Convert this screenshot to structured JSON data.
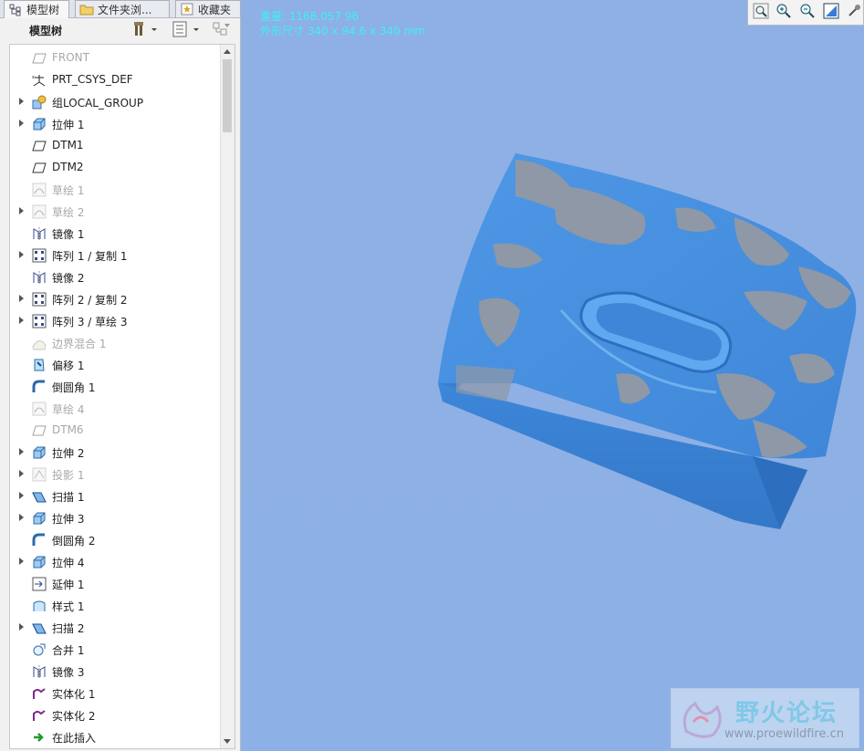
{
  "tabs": [
    {
      "label": "模型树",
      "icon": "model-tree-icon",
      "active": true
    },
    {
      "label": "文件夹浏...",
      "icon": "folder-icon",
      "active": false
    },
    {
      "label": "收藏夹",
      "icon": "favorites-icon",
      "active": false
    }
  ],
  "toolbar": {
    "title": "模型树",
    "settings_icon": "tools-settings-icon",
    "show_icon": "show-list-icon",
    "filter_icon": "filter-icon"
  },
  "tree": [
    {
      "label": "FRONT",
      "icon": "datum-plane-icon",
      "expandable": false,
      "dim": true
    },
    {
      "label": "PRT_CSYS_DEF",
      "icon": "csys-icon",
      "expandable": false,
      "dim": false
    },
    {
      "label": "组LOCAL_GROUP",
      "icon": "group-icon",
      "expandable": true,
      "dim": false
    },
    {
      "label": "拉伸 1",
      "icon": "extrude-icon",
      "expandable": true,
      "dim": false
    },
    {
      "label": "DTM1",
      "icon": "datum-plane-icon",
      "expandable": false,
      "dim": false
    },
    {
      "label": "DTM2",
      "icon": "datum-plane-icon",
      "expandable": false,
      "dim": false
    },
    {
      "label": "草绘 1",
      "icon": "sketch-icon",
      "expandable": false,
      "dim": true
    },
    {
      "label": "草绘 2",
      "icon": "sketch-icon",
      "expandable": true,
      "dim": true
    },
    {
      "label": "镜像 1",
      "icon": "mirror-icon",
      "expandable": false,
      "dim": false
    },
    {
      "label": "阵列 1 / 复制 1",
      "icon": "pattern-icon",
      "expandable": true,
      "dim": false
    },
    {
      "label": "镜像 2",
      "icon": "mirror-icon",
      "expandable": false,
      "dim": false
    },
    {
      "label": "阵列 2 / 复制 2",
      "icon": "pattern-icon",
      "expandable": true,
      "dim": false
    },
    {
      "label": "阵列 3 / 草绘 3",
      "icon": "pattern-icon",
      "expandable": true,
      "dim": false
    },
    {
      "label": "边界混合 1",
      "icon": "boundary-blend-icon",
      "expandable": false,
      "dim": true
    },
    {
      "label": "偏移 1",
      "icon": "offset-icon",
      "expandable": false,
      "dim": false
    },
    {
      "label": "倒圆角 1",
      "icon": "round-icon",
      "expandable": false,
      "dim": false
    },
    {
      "label": "草绘 4",
      "icon": "sketch-icon",
      "expandable": false,
      "dim": true
    },
    {
      "label": "DTM6",
      "icon": "datum-plane-icon",
      "expandable": false,
      "dim": true
    },
    {
      "label": "拉伸 2",
      "icon": "extrude-icon",
      "expandable": true,
      "dim": false
    },
    {
      "label": "投影 1",
      "icon": "projection-icon",
      "expandable": true,
      "dim": true
    },
    {
      "label": "扫描 1",
      "icon": "sweep-icon",
      "expandable": true,
      "dim": false
    },
    {
      "label": "拉伸 3",
      "icon": "extrude-icon",
      "expandable": true,
      "dim": false
    },
    {
      "label": "倒圆角 2",
      "icon": "round-icon",
      "expandable": false,
      "dim": false
    },
    {
      "label": "拉伸 4",
      "icon": "extrude-icon",
      "expandable": true,
      "dim": false
    },
    {
      "label": "延伸 1",
      "icon": "extend-icon",
      "expandable": false,
      "dim": false
    },
    {
      "label": "样式 1",
      "icon": "style-icon",
      "expandable": false,
      "dim": false
    },
    {
      "label": "扫描 2",
      "icon": "sweep-icon",
      "expandable": true,
      "dim": false
    },
    {
      "label": "合并 1",
      "icon": "merge-icon",
      "expandable": false,
      "dim": false
    },
    {
      "label": "镜像 3",
      "icon": "mirror-icon",
      "expandable": false,
      "dim": false
    },
    {
      "label": "实体化 1",
      "icon": "solidify-icon",
      "expandable": false,
      "dim": false
    },
    {
      "label": "实体化 2",
      "icon": "solidify-icon",
      "expandable": false,
      "dim": false
    },
    {
      "label": "在此插入",
      "icon": "insert-here-arrow-icon",
      "expandable": false,
      "dim": false
    }
  ],
  "viewport": {
    "mass_line": "重量: 1168.057 96",
    "size_line": "外形尺寸 340 x 94.6 x 340 mm",
    "background_color": "#8fb1e6",
    "model_color": "#4a90e2",
    "tools": [
      "zoom-window-icon",
      "zoom-in-icon",
      "zoom-out-icon",
      "refit-icon",
      "pin-icon"
    ]
  },
  "watermark": {
    "title": "野火论坛",
    "url": "www.proewildfire.cn"
  }
}
